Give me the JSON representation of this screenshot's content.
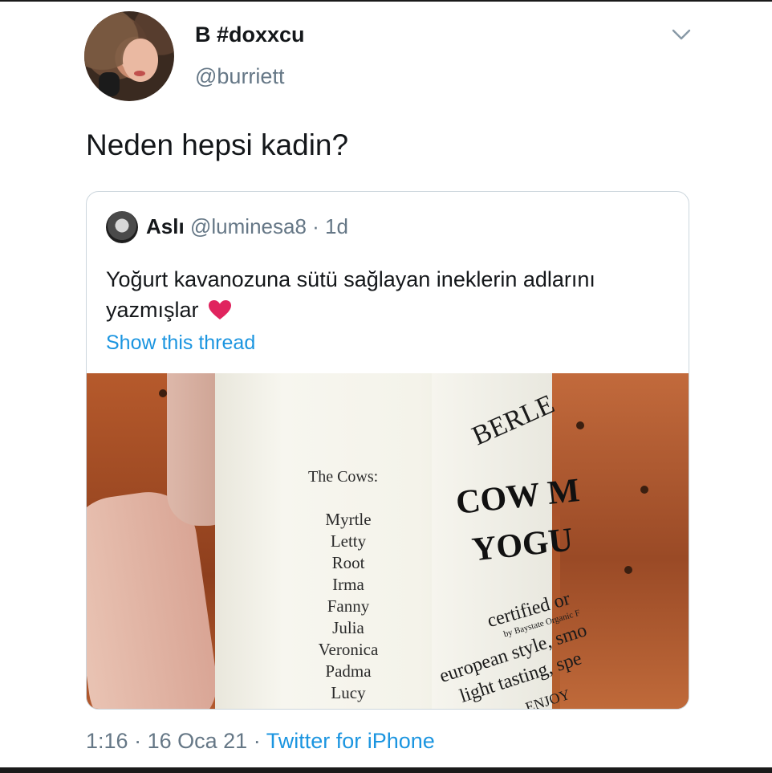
{
  "author": {
    "display_name": "B #doxxcu",
    "username": "@burriett"
  },
  "tweet": {
    "text": "Neden hepsi kadin?",
    "time": "1:16",
    "separator": "·",
    "date": "16 Oca 21",
    "source": "Twitter for iPhone"
  },
  "quoted_tweet": {
    "display_name": "Aslı",
    "username": "@luminesa8",
    "separator": "·",
    "age": "1d",
    "text_line1": "Yoğurt kavanozuna sütü sağlayan ineklerin adlarını",
    "text_line2": "yazmışlar",
    "show_thread": "Show this thread"
  },
  "photo": {
    "cows_title": "The Cows:",
    "cow_names": [
      "Myrtle",
      "Letty",
      "Root",
      "Irma",
      "Fanny",
      "Julia",
      "Veronica",
      "Padma",
      "Lucy"
    ],
    "brand": "BERLE",
    "label_line1": "COW M",
    "label_line2": "YOGU",
    "label_certified": "certified or",
    "label_by": "by Baystate Organic F",
    "label_european": "european style, smo",
    "label_light": "light tasting, spe",
    "label_enjoy": "ENJOY"
  },
  "icons": {
    "chevron": "chevron-down-icon",
    "heart": "heart-icon"
  },
  "colors": {
    "link": "#1b95e0",
    "secondary_text": "#657786",
    "heart": "#e0245e"
  }
}
